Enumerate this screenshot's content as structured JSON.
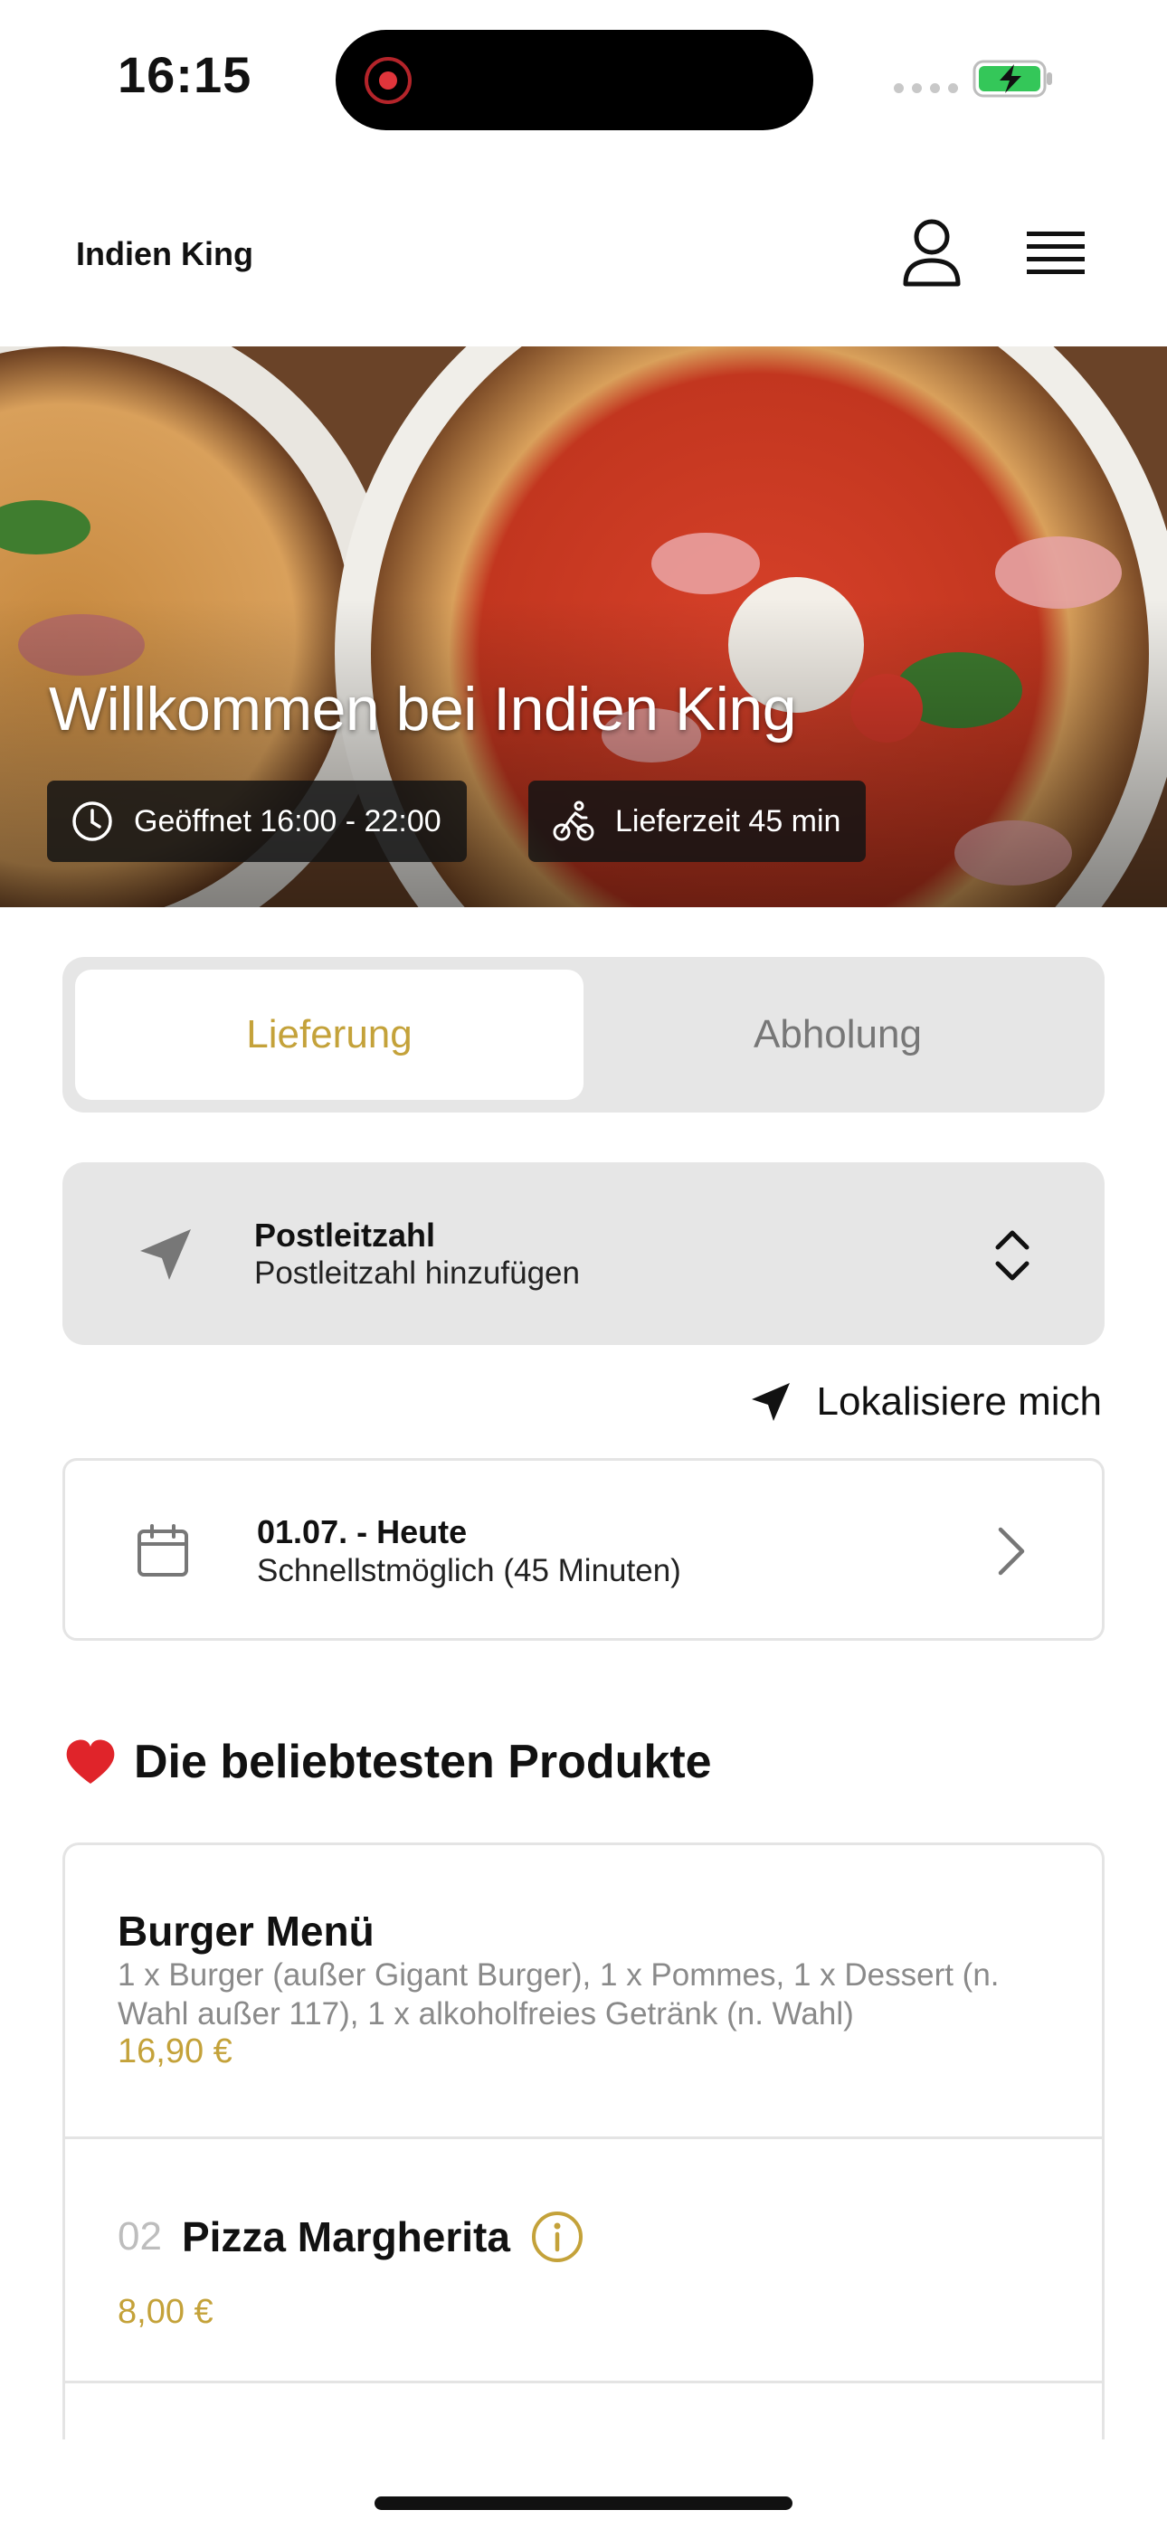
{
  "status_bar": {
    "time": "16:15"
  },
  "header": {
    "brand": "Indien King"
  },
  "hero": {
    "title": "Willkommen bei Indien King",
    "opening_hours": "Geöffnet 16:00 - 22:00",
    "delivery_time": "Lieferzeit 45 min"
  },
  "order_type": {
    "delivery": "Lieferung",
    "pickup": "Abholung",
    "selected": "Lieferung"
  },
  "postcode": {
    "label": "Postleitzahl",
    "placeholder": "Postleitzahl hinzufügen"
  },
  "locate": {
    "label": "Lokalisiere mich"
  },
  "date": {
    "title": "01.07. - Heute",
    "subtitle": "Schnellstmöglich (45 Minuten)"
  },
  "popular": {
    "title": "Die beliebtesten Produkte",
    "items": [
      {
        "name": "Burger Menü",
        "description": "1 x Burger (außer Gigant Burger), 1 x Pommes, 1 x Dessert (n. Wahl außer 117), 1 x alkoholfreies Getränk (n. Wahl)",
        "price": "16,90 €"
      },
      {
        "number": "02",
        "name": "Pizza Margherita",
        "price": "8,00 €"
      }
    ]
  },
  "colors": {
    "accent": "#c4a23a",
    "panel": "#e6e6e6",
    "chip_bg": "#141414"
  }
}
